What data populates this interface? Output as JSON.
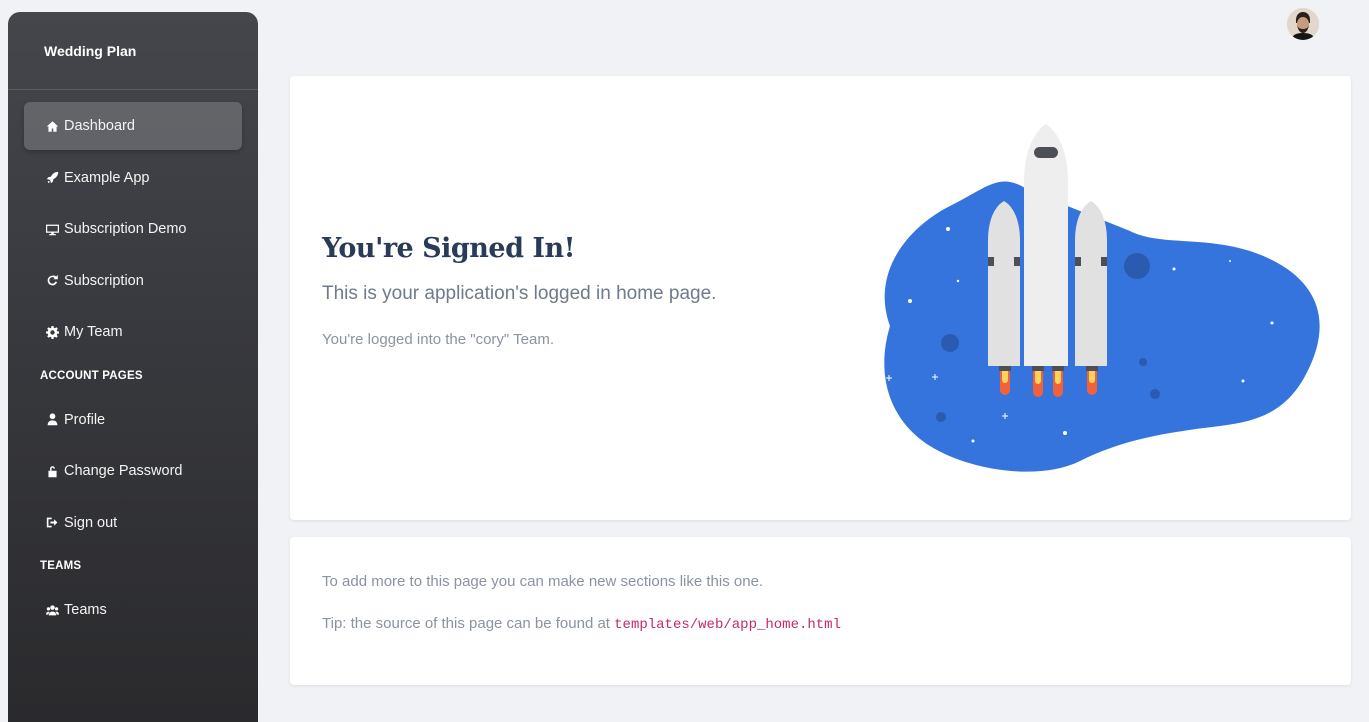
{
  "brand": "Wedding Plan",
  "sidebar": {
    "items": [
      {
        "label": "Dashboard",
        "icon": "home-icon"
      },
      {
        "label": "Example App",
        "icon": "rocket-icon"
      },
      {
        "label": "Subscription Demo",
        "icon": "desktop-icon"
      },
      {
        "label": "Subscription",
        "icon": "refresh-icon"
      },
      {
        "label": "My Team",
        "icon": "gear-icon"
      }
    ],
    "account_label": "ACCOUNT PAGES",
    "account_items": [
      {
        "label": "Profile",
        "icon": "user-icon"
      },
      {
        "label": "Change Password",
        "icon": "unlock-icon"
      },
      {
        "label": "Sign out",
        "icon": "sign-out-icon"
      }
    ],
    "teams_label": "TEAMS",
    "teams_items": [
      {
        "label": "Teams",
        "icon": "users-icon"
      }
    ]
  },
  "main": {
    "title": "You're Signed In!",
    "subtitle": "This is your application's logged in home page.",
    "team_line": "You're logged into the \"cory\" Team.",
    "section2_text": "To add more to this page you can make new sections like this one.",
    "tip_prefix": "Tip: the source of this page can be found at",
    "tip_code": "templates/web/app_home.html"
  },
  "colors": {
    "accent_blue": "#3574dc",
    "title_color": "#2a3b57",
    "code_color": "#c5286c"
  }
}
